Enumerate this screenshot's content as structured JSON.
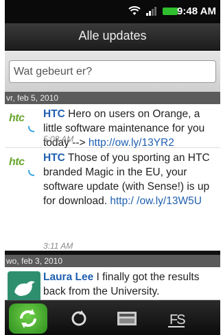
{
  "status": {
    "time": "9:48 AM"
  },
  "title": "Alle updates",
  "input": {
    "placeholder": "Wat gebeurt er?"
  },
  "sections": [
    {
      "date": "vr, feb 5, 2010",
      "items": [
        {
          "author": "HTC",
          "text": "Hero on users on Orange, a little software maintenance for you today --> ",
          "link": "http://ow.ly/13YR2",
          "time": "5:08 AM"
        },
        {
          "author": "HTC",
          "text": "Those of you sporting an HTC branded Magic in the EU, your software update (with Sense!) is up for download. ",
          "link": "http:/ /ow.ly/13W5U",
          "time": "3:11 AM"
        }
      ]
    },
    {
      "date": "wo, feb 3, 2010",
      "items": [
        {
          "author": "Laura Lee",
          "text": "I finally got the results back from the University."
        }
      ]
    }
  ],
  "htc_logo_text": "htc",
  "tabs": [
    {
      "icon": "refresh-all-icon",
      "active": true
    },
    {
      "icon": "refresh-icon",
      "active": false
    },
    {
      "icon": "messages-icon",
      "active": false
    },
    {
      "icon": "people-icon",
      "active": false
    }
  ]
}
